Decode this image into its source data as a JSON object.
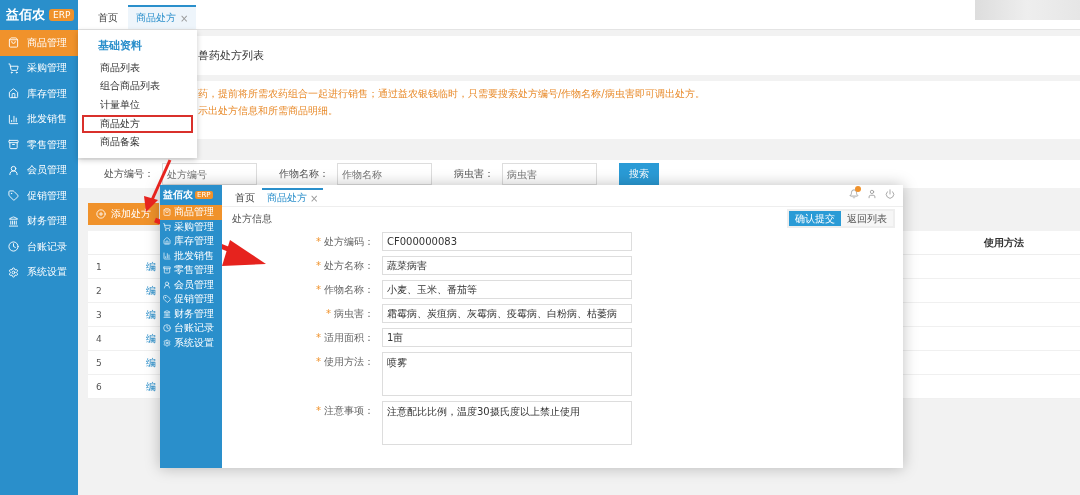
{
  "sidebar": {
    "logo": "益佰农",
    "badge": "ERP",
    "items": [
      {
        "label": "商品管理",
        "selected": true
      },
      {
        "label": "采购管理",
        "selected": false
      },
      {
        "label": "库存管理",
        "selected": false
      },
      {
        "label": "批发销售",
        "selected": false
      },
      {
        "label": "零售管理",
        "selected": false
      },
      {
        "label": "会员管理",
        "selected": false
      },
      {
        "label": "促销管理",
        "selected": false
      },
      {
        "label": "财务管理",
        "selected": false
      },
      {
        "label": "台账记录",
        "selected": false
      },
      {
        "label": "系统设置",
        "selected": false
      }
    ]
  },
  "tabs": [
    {
      "label": "首页",
      "selected": false
    },
    {
      "label": "商品处方",
      "selected": true,
      "close": "×"
    }
  ],
  "page_title": "兽药处方列表",
  "notes": [
    "药，提前将所需农药组合一起进行销售；通过益农银钱临时，只需要搜索处方编号/作物名称/病虫害即可调出处方。",
    "示出处方信息和所需商品明细。"
  ],
  "search": {
    "fields": [
      {
        "label": "处方编号：",
        "placeholder": "处方编号"
      },
      {
        "label": "作物名称：",
        "placeholder": "作物名称"
      },
      {
        "label": "病虫害：",
        "placeholder": "病虫害"
      }
    ],
    "button": "搜索"
  },
  "add_button": "添加处方",
  "table": {
    "columns": [
      "使用方法"
    ],
    "rows": [
      {
        "index": "1",
        "action": "编"
      },
      {
        "index": "2",
        "action": "编"
      },
      {
        "index": "3",
        "action": "编"
      },
      {
        "index": "4",
        "action": "编"
      },
      {
        "index": "5",
        "action": "编"
      },
      {
        "index": "6",
        "action": "编"
      }
    ]
  },
  "menu_popup": {
    "heading": "基础资料",
    "items": [
      {
        "label": "商品列表",
        "highlighted": false
      },
      {
        "label": "组合商品列表",
        "highlighted": false
      },
      {
        "label": "计量单位",
        "highlighted": false
      },
      {
        "label": "商品处方",
        "highlighted": true
      },
      {
        "label": "商品备案",
        "highlighted": false
      }
    ]
  },
  "inset": {
    "logo": "益佰农",
    "badge": "ERP",
    "menu": [
      {
        "label": "商品管理",
        "selected": true
      },
      {
        "label": "采购管理",
        "selected": false
      },
      {
        "label": "库存管理",
        "selected": false
      },
      {
        "label": "批发销售",
        "selected": false
      },
      {
        "label": "零售管理",
        "selected": false
      },
      {
        "label": "会员管理",
        "selected": false
      },
      {
        "label": "促销管理",
        "selected": false
      },
      {
        "label": "财务管理",
        "selected": false
      },
      {
        "label": "台账记录",
        "selected": false
      },
      {
        "label": "系统设置",
        "selected": false
      }
    ],
    "tabs": [
      {
        "label": "首页",
        "selected": false
      },
      {
        "label": "商品处方",
        "selected": true,
        "close": "×"
      }
    ],
    "section_title": "处方信息",
    "buttons": [
      {
        "label": "确认提交",
        "kind": "primary"
      },
      {
        "label": "返回列表",
        "kind": "default"
      }
    ],
    "fields": [
      {
        "mark": "*",
        "label": "处方编码：",
        "value": "CF000000083",
        "kind": "input"
      },
      {
        "mark": "*",
        "label": "处方名称：",
        "value": "蔬菜病害",
        "kind": "input"
      },
      {
        "mark": "*",
        "label": "作物名称：",
        "value": "小麦、玉米、番茄等",
        "kind": "input"
      },
      {
        "mark": "*",
        "label": "病虫害：",
        "value": "霜霉病、炭疽病、灰霉病、疫霉病、白粉病、枯萎病",
        "kind": "input"
      },
      {
        "mark": "*",
        "label": "适用面积：",
        "value": "1亩",
        "kind": "input"
      },
      {
        "mark": "*",
        "label": "使用方法：",
        "value": "喷雾",
        "kind": "textarea"
      },
      {
        "mark": "*",
        "label": "注意事项：",
        "value": "注意配比比例，温度30摄氏度以上禁止使用",
        "kind": "textarea"
      }
    ]
  }
}
